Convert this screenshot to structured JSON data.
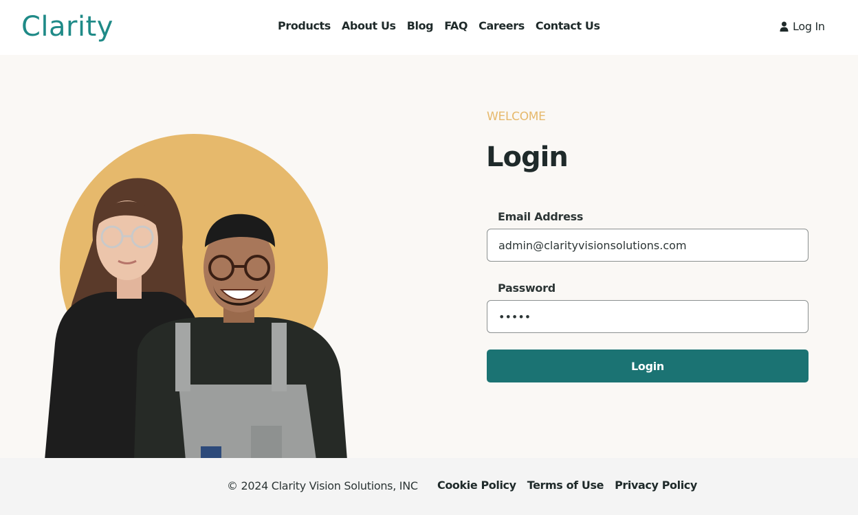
{
  "header": {
    "logo": "Clarity",
    "nav": [
      "Products",
      "About Us",
      "Blog",
      "FAQ",
      "Careers",
      "Contact Us"
    ],
    "login_link": "Log In"
  },
  "main": {
    "eyebrow": "WELCOME",
    "title": "Login",
    "email": {
      "label": "Email Address",
      "value": "admin@clarityvisionsolutions.com"
    },
    "password": {
      "label": "Password",
      "value": "•••••"
    },
    "submit_label": "Login"
  },
  "footer": {
    "copyright": "© 2024 Clarity Vision Solutions, INC",
    "links": [
      "Cookie Policy",
      "Terms of Use",
      "Privacy Policy"
    ]
  },
  "colors": {
    "brand_teal": "#1b7373",
    "logo_teal": "#1f8a87",
    "accent_gold": "#e6b96c",
    "background": "#faf8f5"
  },
  "icons": {
    "user": "user-icon"
  }
}
